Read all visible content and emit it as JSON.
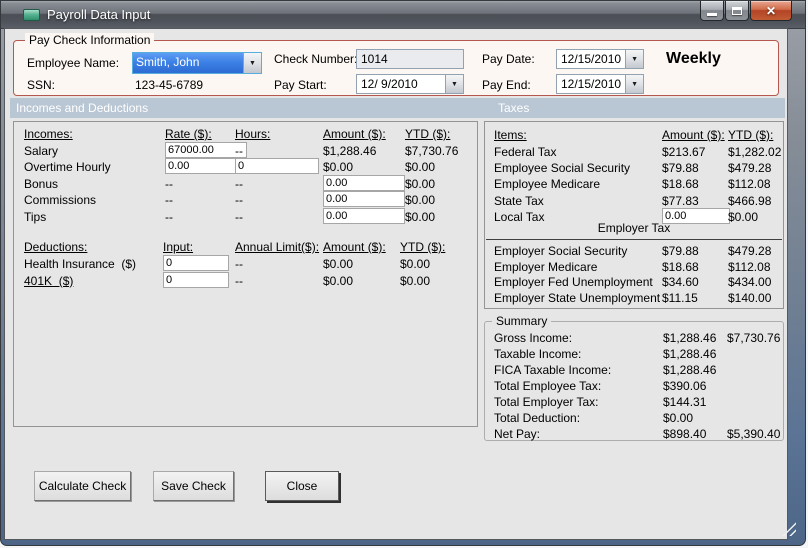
{
  "window": {
    "title": "Payroll Data Input"
  },
  "paycheck": {
    "legend": "Pay Check Information",
    "employee_name_label": "Employee Name:",
    "employee_name": "Smith, John",
    "ssn_label": "SSN:",
    "ssn": "123-45-6789",
    "check_number_label": "Check Number:",
    "check_number": "1014",
    "pay_start_label": "Pay Start:",
    "pay_start": "12/ 9/2010",
    "pay_date_label": "Pay Date:",
    "pay_date": "12/15/2010",
    "pay_end_label": "Pay End:",
    "pay_end": "12/15/2010",
    "frequency": "Weekly"
  },
  "section_headers": {
    "left": "Incomes and Deductions",
    "right": "Taxes"
  },
  "incomes_table": {
    "headers": [
      "Incomes:",
      "Rate ($):",
      "Hours:",
      "Amount ($):",
      "YTD ($):"
    ],
    "rows": [
      [
        {
          "v": "Salary"
        },
        {
          "v": "67000.00",
          "t": "input"
        },
        {
          "v": "--"
        },
        {
          "v": "$1,288.46"
        },
        {
          "v": "$7,730.76"
        }
      ],
      [
        {
          "v": "Overtime Hourly"
        },
        {
          "v": "0.00",
          "t": "input"
        },
        {
          "v": "0",
          "t": "input"
        },
        {
          "v": "$0.00"
        },
        {
          "v": "$0.00"
        }
      ],
      [
        {
          "v": "Bonus"
        },
        {
          "v": "--"
        },
        {
          "v": "--"
        },
        {
          "v": "0.00",
          "t": "input"
        },
        {
          "v": "$0.00"
        }
      ],
      [
        {
          "v": "Commissions"
        },
        {
          "v": "--"
        },
        {
          "v": "--"
        },
        {
          "v": "0.00",
          "t": "input"
        },
        {
          "v": "$0.00"
        }
      ],
      [
        {
          "v": "Tips"
        },
        {
          "v": "--"
        },
        {
          "v": "--"
        },
        {
          "v": "0.00",
          "t": "input"
        },
        {
          "v": "$0.00"
        }
      ]
    ]
  },
  "deductions_table": {
    "headers": [
      "Deductions:",
      "Input:",
      "Annual Limit($):",
      "Amount ($):",
      "YTD ($):"
    ],
    "rows": [
      [
        {
          "v": "Health Insurance  ($)"
        },
        {
          "v": "0",
          "t": "input"
        },
        {
          "v": "--"
        },
        {
          "v": "$0.00"
        },
        {
          "v": "$0.00"
        }
      ],
      [
        {
          "v": "401K  ($)",
          "u": true
        },
        {
          "v": "0",
          "t": "input"
        },
        {
          "v": "--"
        },
        {
          "v": "$0.00"
        },
        {
          "v": "$0.00"
        }
      ]
    ]
  },
  "taxes_table": {
    "headers": [
      "Items:",
      "Amount ($):",
      "YTD ($):"
    ],
    "rows": [
      [
        {
          "v": "Federal Tax"
        },
        {
          "v": "$213.67"
        },
        {
          "v": "$1,282.02"
        }
      ],
      [
        {
          "v": "Employee Social Security"
        },
        {
          "v": "$79.88"
        },
        {
          "v": "$479.28"
        }
      ],
      [
        {
          "v": "Employee Medicare"
        },
        {
          "v": "$18.68"
        },
        {
          "v": "$112.08"
        }
      ],
      [
        {
          "v": "State Tax"
        },
        {
          "v": "$77.83"
        },
        {
          "v": "$466.98"
        }
      ],
      [
        {
          "v": "Local Tax"
        },
        {
          "v": "0.00",
          "t": "input"
        },
        {
          "v": "$0.00"
        }
      ]
    ],
    "employer_section_label": "Employer Tax",
    "employer_rows": [
      [
        {
          "v": "Employer Social Security"
        },
        {
          "v": "$79.88"
        },
        {
          "v": "$479.28"
        }
      ],
      [
        {
          "v": "Employer Medicare"
        },
        {
          "v": "$18.68"
        },
        {
          "v": "$112.08"
        }
      ],
      [
        {
          "v": "Employer Fed Unemployment"
        },
        {
          "v": "$34.60"
        },
        {
          "v": "$434.00"
        }
      ],
      [
        {
          "v": "Employer State Unemployment"
        },
        {
          "v": "$11.15"
        },
        {
          "v": "$140.00"
        }
      ]
    ]
  },
  "summary": {
    "legend": "Summary",
    "rows": [
      [
        {
          "v": "Gross Income:"
        },
        {
          "v": "$1,288.46"
        },
        {
          "v": "$7,730.76"
        }
      ],
      [
        {
          "v": "Taxable Income:"
        },
        {
          "v": "$1,288.46"
        },
        {
          "v": ""
        }
      ],
      [
        {
          "v": "FICA Taxable Income:"
        },
        {
          "v": "$1,288.46"
        },
        {
          "v": ""
        }
      ],
      [
        {
          "v": "Total Employee Tax:"
        },
        {
          "v": "$390.06"
        },
        {
          "v": ""
        }
      ],
      [
        {
          "v": "Total Employer Tax:"
        },
        {
          "v": "$144.31"
        },
        {
          "v": ""
        }
      ],
      [
        {
          "v": "Total Deduction:"
        },
        {
          "v": "$0.00"
        },
        {
          "v": ""
        }
      ],
      [
        {
          "v": "Net Pay:"
        },
        {
          "v": "$898.40"
        },
        {
          "v": "$5,390.40"
        }
      ]
    ]
  },
  "buttons": {
    "calculate": "Calculate Check",
    "save": "Save Check",
    "close": "Close"
  },
  "colors": {
    "group_border": "#b4574e",
    "band_bg": "#b9c6d3",
    "selection_blue": "#3b7ee4",
    "close_button_red": "#b34425",
    "client_bg": "#e6e6e6"
  }
}
